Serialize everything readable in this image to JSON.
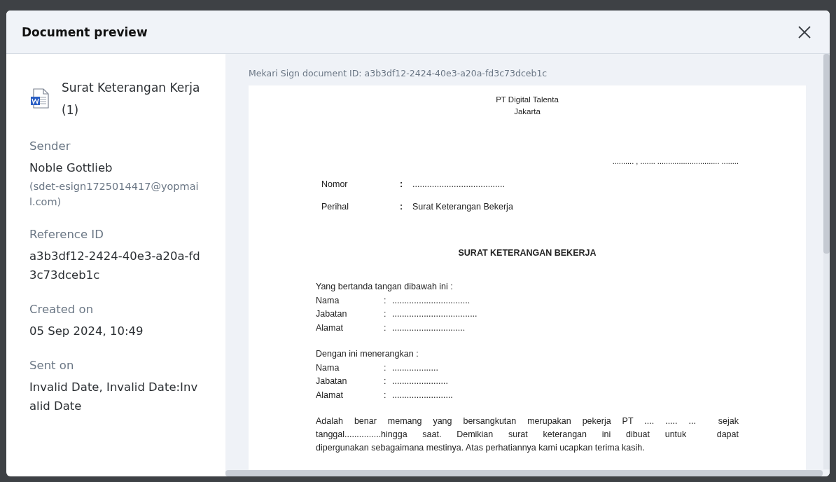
{
  "window": {
    "title": "Document preview"
  },
  "sidebar": {
    "file_name": "Surat Keterangan Kerja (1)",
    "details": [
      {
        "kind": "person",
        "label": "Sender",
        "value": "Noble Gottlieb",
        "note": "(sdet-esign1725014417@yopmail.com)"
      },
      {
        "kind": "text",
        "label": "Reference ID",
        "value": "a3b3df12-2424-40e3-a20a-fd3c73dceb1c"
      },
      {
        "kind": "text",
        "label": "Created on",
        "value": "05 Sep 2024, 10:49"
      },
      {
        "kind": "text",
        "label": "Sent on",
        "value": "Invalid Date, Invalid Date:Invalid Date"
      }
    ]
  },
  "preview": {
    "document_id": "Mekari Sign document ID: a3b3df12-2424-40e3-a20a-fd3c73dceb1c",
    "page": {
      "header": [
        "PT Digital Talenta",
        "Jakarta"
      ],
      "date_line": ".......... , ....... ............................. ........",
      "fields": [
        {
          "label": "Nomor",
          "colon": ":",
          "value": "......................................"
        },
        {
          "label": "Perihal",
          "colon": ":",
          "value": "Surat Keterangan Bekerja"
        }
      ],
      "title": "SURAT KETERANGAN BEKERJA",
      "sections": [
        {
          "intro": "Yang bertanda tangan dibawah ini :",
          "rows": [
            {
              "label": "Nama",
              "colon": ":",
              "value": "................................"
            },
            {
              "label": "Jabatan",
              "colon": ":",
              "value": "..................................."
            },
            {
              "label": "Alamat",
              "colon": ":",
              "value": ".............................."
            }
          ]
        },
        {
          "intro": "Dengan ini menerangkan :",
          "rows": [
            {
              "label": "Nama",
              "colon": ":",
              "value": "..................."
            },
            {
              "label": "Jabatan",
              "colon": ":",
              "value": "......................."
            },
            {
              "label": "Alamat",
              "colon": ":",
              "value": "........................."
            }
          ]
        }
      ],
      "paragraph_lines": [
        "Adalah benar memang yang bersangkutan merupakan pekerja PT .... ..... ...  sejak",
        "tanggal...............hingga saat. Demikian surat keterangan ini dibuat untuk  dapat",
        "dipergunakan sebagaimana mestinya. Atas perhatiannya kami ucapkan terima kasih."
      ]
    }
  }
}
